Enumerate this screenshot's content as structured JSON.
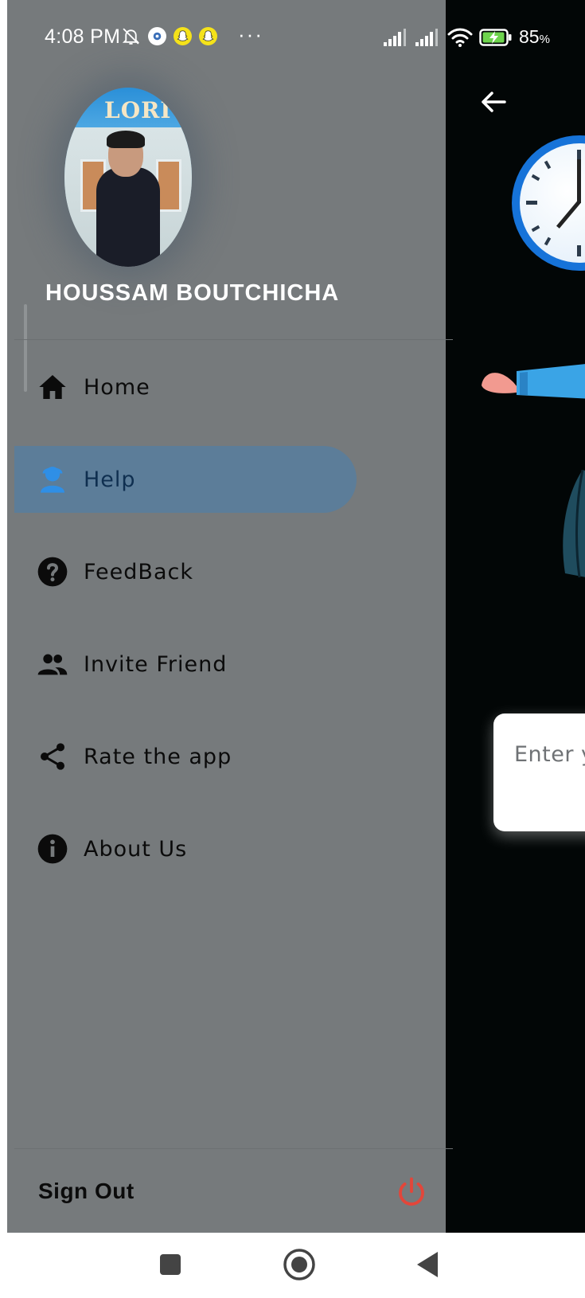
{
  "status_bar": {
    "time": "4:08 PM",
    "more": "···",
    "battery_percent": "85",
    "battery_unit": "%"
  },
  "drawer": {
    "user_name": "HOUSSAM BOUTCHICHA",
    "avatar_sign_text": "LORI",
    "menu": [
      {
        "label": "Home",
        "icon": "home-icon",
        "active": false
      },
      {
        "label": "Help",
        "icon": "support-agent-icon",
        "active": true
      },
      {
        "label": "FeedBack",
        "icon": "help-circle-icon",
        "active": false
      },
      {
        "label": "Invite Friend",
        "icon": "people-icon",
        "active": false
      },
      {
        "label": "Rate the app",
        "icon": "share-icon",
        "active": false
      },
      {
        "label": "About Us",
        "icon": "info-icon",
        "active": false
      }
    ],
    "sign_out_label": "Sign Out"
  },
  "background_screen": {
    "input_placeholder": "Enter y"
  },
  "colors": {
    "drawer_bg": "#767a7c",
    "active_item_bg": "#5c7d99",
    "active_icon": "#2f8fe6",
    "power_icon": "#e2463a",
    "behind_bg": "#020606",
    "clock_ring": "#1673d9"
  }
}
